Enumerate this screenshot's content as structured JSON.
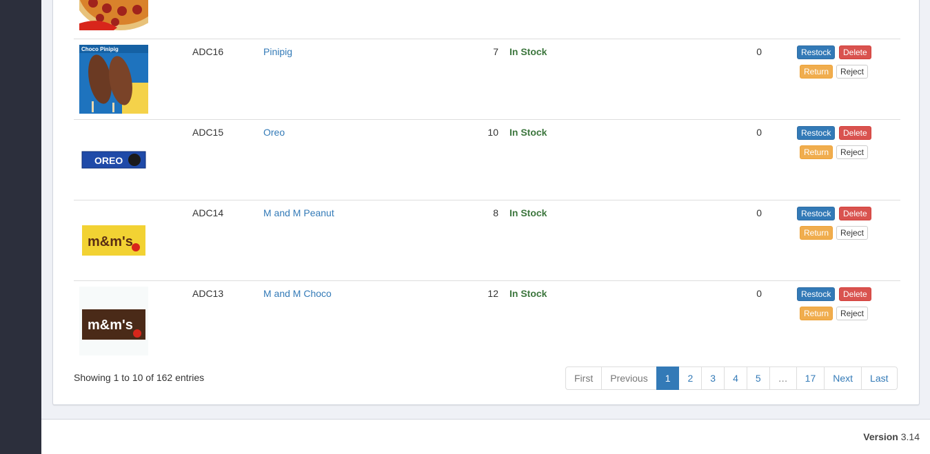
{
  "table": {
    "rows": [
      {
        "code": "ADC16",
        "name": "Pinipig",
        "qty": "7",
        "status": "In Stock",
        "count": "0",
        "image": "pinipig-ice-cream",
        "image_text": "Choco Pinipig"
      },
      {
        "code": "ADC15",
        "name": "Oreo",
        "qty": "10",
        "status": "In Stock",
        "count": "0",
        "image": "oreo-pack",
        "image_text": "OREO"
      },
      {
        "code": "ADC14",
        "name": "M and M Peanut",
        "qty": "8",
        "status": "In Stock",
        "count": "0",
        "image": "mm-peanut-pack",
        "image_text": "m&m's"
      },
      {
        "code": "ADC13",
        "name": "M and M Choco",
        "qty": "12",
        "status": "In Stock",
        "count": "0",
        "image": "mm-choco-pack",
        "image_text": "m&m's"
      }
    ],
    "actions": {
      "restock": "Restock",
      "delete": "Delete",
      "return": "Return",
      "reject": "Reject"
    }
  },
  "info": "Showing 1 to 10 of 162 entries",
  "pagination": [
    "First",
    "Previous",
    "1",
    "2",
    "3",
    "4",
    "5",
    "…",
    "17",
    "Next",
    "Last"
  ],
  "footer": {
    "version_label": "Version",
    "version_number": "3.14"
  },
  "colors": {
    "sidebar": "#2c2f3c",
    "primary": "#337ab7",
    "danger": "#d9534f",
    "warning": "#f0ad4e",
    "success_text": "#3c763d"
  }
}
